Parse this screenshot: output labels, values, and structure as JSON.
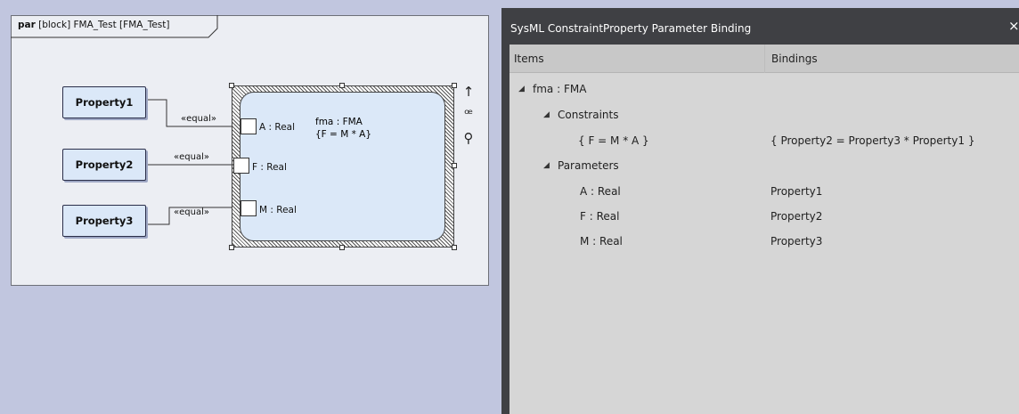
{
  "diagram": {
    "frame_kind": "par",
    "frame_title": "[block] FMA_Test [FMA_Test]",
    "properties": [
      {
        "label": "Property1"
      },
      {
        "label": "Property2"
      },
      {
        "label": "Property3"
      }
    ],
    "connectors": [
      {
        "stereotype": "«equal»"
      },
      {
        "stereotype": "«equal»"
      },
      {
        "stereotype": "«equal»"
      }
    ],
    "constraint": {
      "name": "fma : FMA",
      "equation": "{F = M * A}",
      "ports": [
        {
          "label": "A : Real"
        },
        {
          "label": "F : Real"
        },
        {
          "label": "M : Real"
        }
      ]
    },
    "toolbar": {
      "arrow": "↑",
      "brush": "ꟹ",
      "zoom": "⚲"
    }
  },
  "dialog": {
    "title": "SysML ConstraintProperty Parameter Binding",
    "close": "×",
    "columns": {
      "items": "Items",
      "bindings": "Bindings"
    },
    "tree": {
      "root": "fma : FMA",
      "constraints_label": "Constraints",
      "constraint_item": "{ F = M * A }",
      "constraint_binding": "{ Property2 = Property3 * Property1 }",
      "parameters_label": "Parameters",
      "parameters": [
        {
          "name": "A : Real",
          "binding": "Property1"
        },
        {
          "name": "F : Real",
          "binding": "Property2"
        },
        {
          "name": "M : Real",
          "binding": "Property3"
        }
      ]
    }
  }
}
